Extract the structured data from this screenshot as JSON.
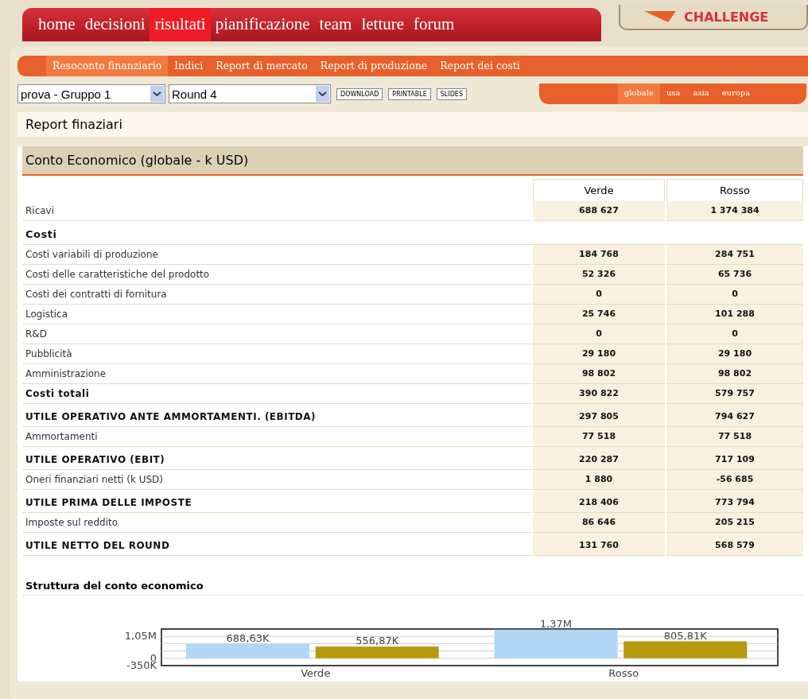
{
  "main_nav": [
    {
      "label": "home",
      "selected": false
    },
    {
      "label": "decisioni",
      "selected": false
    },
    {
      "label": "risultati",
      "selected": true
    },
    {
      "label": "pianificazione",
      "selected": false
    },
    {
      "label": "team",
      "selected": false
    },
    {
      "label": "letture",
      "selected": false
    },
    {
      "label": "forum",
      "selected": false
    }
  ],
  "logo": {
    "text": "CHALLENGE"
  },
  "sub_nav": [
    {
      "label": "Resoconto finanziario",
      "selected": true
    },
    {
      "label": "Indici",
      "selected": false
    },
    {
      "label": "Report di mercato",
      "selected": false
    },
    {
      "label": "Report di produzione",
      "selected": false
    },
    {
      "label": "Report dei costi",
      "selected": false
    }
  ],
  "team_select": {
    "value": "prova - Gruppo 1"
  },
  "round_select": {
    "value": "Round 4"
  },
  "buttons": [
    "DOWNLOAD",
    "PRINTABLE",
    "SLIDES"
  ],
  "region_tabs": [
    {
      "label": "globale",
      "selected": true
    },
    {
      "label": "usa",
      "selected": false
    },
    {
      "label": "asia",
      "selected": false
    },
    {
      "label": "europa",
      "selected": false
    }
  ],
  "page_title": "Report finaziari",
  "section": {
    "title": "Conto Economico (globale - k USD)",
    "columns": [
      "Verde",
      "Rosso"
    ],
    "rows": [
      {
        "kind": "plain",
        "label": "Ricavi",
        "values": [
          "688 627",
          "1 374 384"
        ]
      },
      {
        "kind": "heading",
        "label": "Costi"
      },
      {
        "kind": "plain",
        "label": "Costi variabili di produzione",
        "values": [
          "184 768",
          "284 751"
        ]
      },
      {
        "kind": "plain",
        "label": "Costi delle caratteristiche del prodotto",
        "values": [
          "52 326",
          "65 736"
        ]
      },
      {
        "kind": "plain",
        "label": "Costi dei contratti di fornitura",
        "values": [
          "0",
          "0"
        ]
      },
      {
        "kind": "plain",
        "label": "Logistica",
        "values": [
          "25 746",
          "101 288"
        ]
      },
      {
        "kind": "plain",
        "label": "R&D",
        "values": [
          "0",
          "0"
        ]
      },
      {
        "kind": "plain",
        "label": "Pubblicità",
        "values": [
          "29 180",
          "29 180"
        ]
      },
      {
        "kind": "plain",
        "label": "Amministrazione",
        "values": [
          "98 802",
          "98 802"
        ]
      },
      {
        "kind": "total",
        "label": "Costi totali",
        "values": [
          "390 822",
          "579 757"
        ]
      },
      {
        "kind": "result",
        "label": "UTILE OPERATIVO ANTE AMMORTAMENTI. (EBITDA)",
        "values": [
          "297 805",
          "794 627"
        ]
      },
      {
        "kind": "plain",
        "label": "Ammortamenti",
        "values": [
          "77 518",
          "77 518"
        ]
      },
      {
        "kind": "result",
        "label": "UTILE OPERATIVO (EBIT)",
        "values": [
          "220 287",
          "717 109"
        ]
      },
      {
        "kind": "plain",
        "label": "Oneri finanziari netti (k USD)",
        "values": [
          "1 880",
          "-56 685"
        ]
      },
      {
        "kind": "result",
        "label": "UTILE PRIMA DELLE IMPOSTE",
        "values": [
          "218 406",
          "773 794"
        ]
      },
      {
        "kind": "plain",
        "label": "Imposte sul reddito",
        "values": [
          "86 646",
          "205 215"
        ]
      },
      {
        "kind": "result",
        "label": "UTILE NETTO DEL ROUND",
        "values": [
          "131 760",
          "568 579"
        ]
      }
    ]
  },
  "chart_section": {
    "title": "Struttura del conto economico",
    "chart_data": {
      "type": "bar",
      "categories": [
        "Verde",
        "Rosso"
      ],
      "series": [
        {
          "color": "#b0d8f5",
          "values": [
            690000,
            1370000
          ]
        },
        {
          "color": "#b89a10",
          "values": [
            560000,
            810000
          ]
        }
      ],
      "ylim": [
        -350000,
        1400000
      ],
      "yticks": [
        {
          "value": 1050000,
          "label": "1,05M"
        },
        {
          "value": 0,
          "label": "0"
        },
        {
          "value": -350000,
          "label": "-350K"
        }
      ],
      "value_labels": [
        [
          "688,63K",
          "1,37M"
        ],
        [
          "556,87K",
          "805,81K"
        ]
      ]
    }
  }
}
